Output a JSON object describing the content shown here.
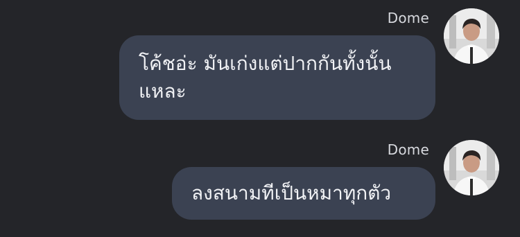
{
  "messages": [
    {
      "sender": "Dome",
      "text": "โค้ชอ่ะ มันเก่งแต่ปากกันทั้งนั้นแหละ",
      "avatar_icon": "profile-photo-man-in-white-shirt"
    },
    {
      "sender": "Dome",
      "text": "ลงสนามทีเป็นหมาทุกตัว",
      "avatar_icon": "profile-photo-man-in-white-shirt"
    }
  ],
  "colors": {
    "background": "#242529",
    "bubble": "#3b4252",
    "bubble_text": "#f1f2f5",
    "sender_text": "#d7d9de"
  }
}
